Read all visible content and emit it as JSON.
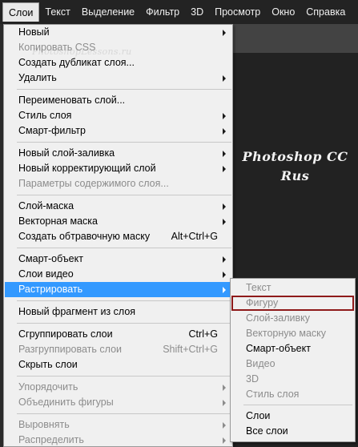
{
  "menubar": {
    "items": [
      "Слои",
      "Текст",
      "Выделение",
      "Фильтр",
      "3D",
      "Просмотр",
      "Окно",
      "Справка"
    ]
  },
  "workspace": {
    "watermark": "PhotoshopLessons.ru",
    "brand_line1": "Photoshop CC",
    "brand_line2": "Rus"
  },
  "menu": {
    "items": [
      {
        "label": "Новый",
        "submenu": true
      },
      {
        "label": "Копировать CSS",
        "disabled": true
      },
      {
        "label": "Создать дубликат слоя..."
      },
      {
        "label": "Удалить",
        "submenu": true
      },
      {
        "label": "Переименовать слой..."
      },
      {
        "label": "Стиль слоя",
        "submenu": true
      },
      {
        "label": "Смарт-фильтр",
        "submenu": true
      },
      {
        "label": "Новый слой-заливка",
        "submenu": true
      },
      {
        "label": "Новый корректирующий слой",
        "submenu": true
      },
      {
        "label": "Параметры содержимого слоя...",
        "disabled": true
      },
      {
        "label": "Слой-маска",
        "submenu": true
      },
      {
        "label": "Векторная маска",
        "submenu": true
      },
      {
        "label": "Создать обтравочную маску",
        "shortcut": "Alt+Ctrl+G"
      },
      {
        "label": "Смарт-объект",
        "submenu": true
      },
      {
        "label": "Слои видео",
        "submenu": true
      },
      {
        "label": "Растрировать",
        "submenu": true,
        "highlight": true
      },
      {
        "label": "Новый фрагмент из слоя"
      },
      {
        "label": "Сгруппировать слои",
        "shortcut": "Ctrl+G"
      },
      {
        "label": "Разгруппировать слои",
        "shortcut": "Shift+Ctrl+G",
        "disabled": true
      },
      {
        "label": "Скрыть слои"
      },
      {
        "label": "Упорядочить",
        "submenu": true,
        "disabled": true
      },
      {
        "label": "Объединить фигуры",
        "submenu": true,
        "disabled": true
      },
      {
        "label": "Выровнять",
        "submenu": true,
        "disabled": true
      },
      {
        "label": "Распределить",
        "submenu": true,
        "disabled": true
      }
    ]
  },
  "submenu": {
    "items": [
      {
        "label": "Текст",
        "disabled": true
      },
      {
        "label": "Фигуру",
        "disabled": true,
        "boxed": true
      },
      {
        "label": "Слой-заливку",
        "disabled": true
      },
      {
        "label": "Векторную маску",
        "disabled": true
      },
      {
        "label": "Смарт-объект"
      },
      {
        "label": "Видео",
        "disabled": true
      },
      {
        "label": "3D",
        "disabled": true
      },
      {
        "label": "Стиль слоя",
        "disabled": true
      },
      {
        "label": "Слои"
      },
      {
        "label": "Все слои"
      }
    ]
  },
  "colors": {
    "menubar_bg": "#232323",
    "menu_bg": "#f0f0f0",
    "highlight": "#3399ff",
    "disabled_text": "#8c8c8c",
    "boxed_outline": "#8e1a1a"
  }
}
